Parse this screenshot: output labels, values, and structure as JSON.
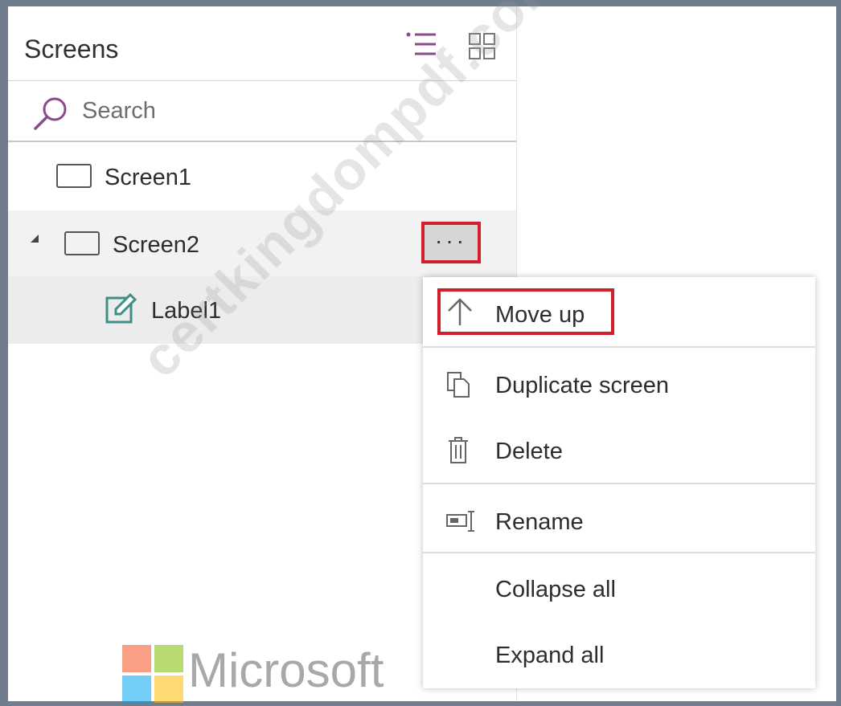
{
  "panel": {
    "title": "Screens",
    "icons": [
      "tree-view-icon",
      "grid-view-icon"
    ],
    "accent_color": "#8b4b8b"
  },
  "search": {
    "placeholder": "Search",
    "value": "",
    "icon": "search-icon"
  },
  "tree": {
    "items": [
      {
        "label": "Screen1",
        "icon": "screen-icon",
        "expanded": false,
        "selected": false
      },
      {
        "label": "Screen2",
        "icon": "screen-icon",
        "expanded": true,
        "selected": true
      },
      {
        "label": "Label1",
        "icon": "label-edit-icon",
        "selected": false
      }
    ],
    "more_label": "···"
  },
  "context_menu": {
    "items": [
      {
        "label": "Move up",
        "icon": "arrow-up-icon"
      },
      {
        "label": "Duplicate screen",
        "icon": "duplicate-icon"
      },
      {
        "label": "Delete",
        "icon": "trash-icon"
      },
      {
        "label": "Rename",
        "icon": "rename-icon"
      },
      {
        "label": "Collapse all",
        "icon": ""
      },
      {
        "label": "Expand all",
        "icon": ""
      }
    ]
  },
  "watermark": "certkingdompdf.com",
  "brand": {
    "name": "Microsoft",
    "logo_colors": [
      "#f25022",
      "#7fba00",
      "#00a4ef",
      "#ffb900"
    ]
  },
  "highlight_color": "#d21f2b"
}
